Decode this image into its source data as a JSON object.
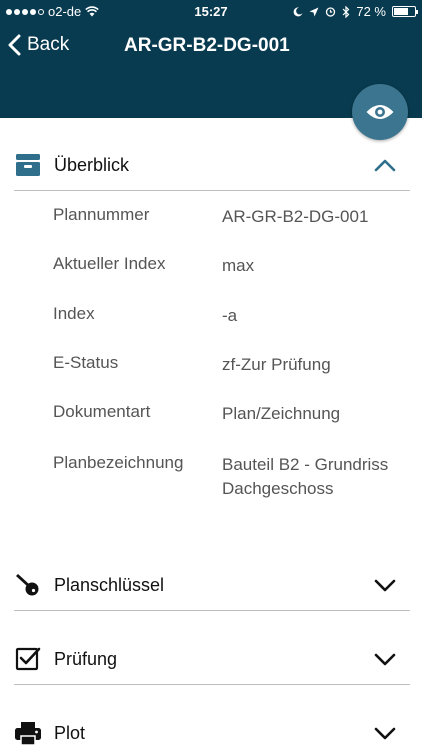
{
  "status_bar": {
    "carrier": "o2-de",
    "time": "15:27",
    "battery": "72 %",
    "battery_level": 0.72
  },
  "nav": {
    "back_label": "Back",
    "title": "AR-GR-B2-DG-001"
  },
  "sections": {
    "overview": {
      "title": "Überblick",
      "fields": [
        {
          "label": "Plannummer",
          "value": "AR-GR-B2-DG-001"
        },
        {
          "label": "Aktueller Index",
          "value": "max"
        },
        {
          "label": "Index",
          "value": "-a"
        },
        {
          "label": "E-Status",
          "value": "zf-Zur Prüfung"
        },
        {
          "label": "Dokumentart",
          "value": "Plan/Zeichnung"
        },
        {
          "label": "Planbezeichnung",
          "value": "Bauteil B2 - Grundriss Dachgeschoss"
        }
      ]
    },
    "planschluessel": {
      "title": "Planschlüssel"
    },
    "pruefung": {
      "title": "Prüfung"
    },
    "plot": {
      "title": "Plot"
    }
  },
  "colors": {
    "header": "#083b4f",
    "fab": "#3c7590",
    "accent_icon": "#2f6f8c"
  }
}
